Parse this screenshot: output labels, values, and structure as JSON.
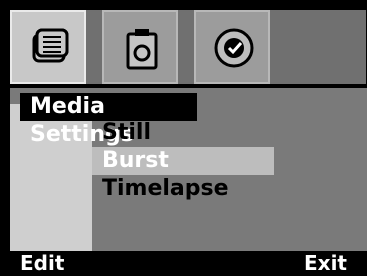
{
  "tabs": [
    {
      "name": "Media Settings",
      "icon": "media-list-icon",
      "active": true
    },
    {
      "name": "Camera",
      "icon": "camera-icon",
      "active": false
    },
    {
      "name": "Confirm",
      "icon": "checkmark-icon",
      "active": false
    }
  ],
  "menu": {
    "title": "Media Settings",
    "items": [
      {
        "label": "Still"
      },
      {
        "label": "Burst",
        "selected": true
      },
      {
        "label": "Timelapse"
      }
    ]
  },
  "softkeys": {
    "left": "Edit",
    "right": "Exit"
  },
  "colors": {
    "background": "#000000",
    "menu": "#7a7a7a",
    "sidebar": "#cfcfcf",
    "selected": "#bdbdbd",
    "title": "#000000"
  }
}
